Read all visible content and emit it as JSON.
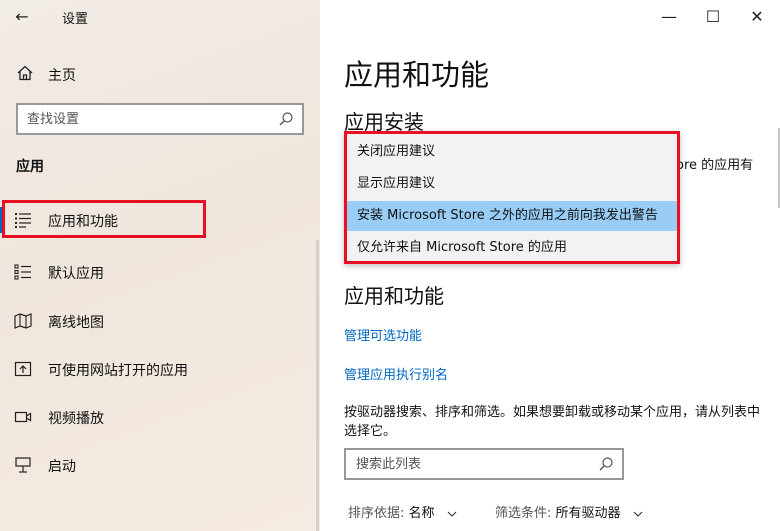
{
  "window": {
    "title": "设置",
    "minimize_symbol": "—",
    "maximize_symbol": "☐",
    "close_symbol": "✕",
    "back_symbol": "←"
  },
  "sidebar": {
    "home_label": "主页",
    "search_placeholder": "查找设置",
    "section_header": "应用",
    "items": [
      {
        "label": "应用和功能",
        "icon": "apps-features-icon",
        "active": true
      },
      {
        "label": "默认应用",
        "icon": "default-apps-icon",
        "active": false
      },
      {
        "label": "离线地图",
        "icon": "offline-maps-icon",
        "active": false
      },
      {
        "label": "可使用网站打开的应用",
        "icon": "apps-for-websites-icon",
        "active": false
      },
      {
        "label": "视频播放",
        "icon": "video-playback-icon",
        "active": false
      },
      {
        "label": "启动",
        "icon": "startup-icon",
        "active": false
      }
    ]
  },
  "main": {
    "page_title": "应用和功能",
    "install_heading": "应用安装",
    "clipped_text": "ore 的应用有",
    "dropdown_options": [
      "关闭应用建议",
      "显示应用建议",
      "安装 Microsoft Store 之外的应用之前向我发出警告",
      "仅允许来自 Microsoft Store 的应用"
    ],
    "dropdown_selected_index": 2,
    "apps_heading": "应用和功能",
    "link_optional_features": "管理可选功能",
    "link_execution_aliases": "管理应用执行别名",
    "description": "按驱动器搜索、排序和筛选。如果想要卸载或移动某个应用，请从列表中选择它。",
    "list_search_placeholder": "搜索此列表",
    "sort_label": "排序依据:",
    "sort_value": "名称",
    "filter_label": "筛选条件:",
    "filter_value": "所有驱动器"
  },
  "colors": {
    "accent": "#0067c0",
    "highlight_red": "#e81123",
    "selected_item": "#99cdf5"
  }
}
